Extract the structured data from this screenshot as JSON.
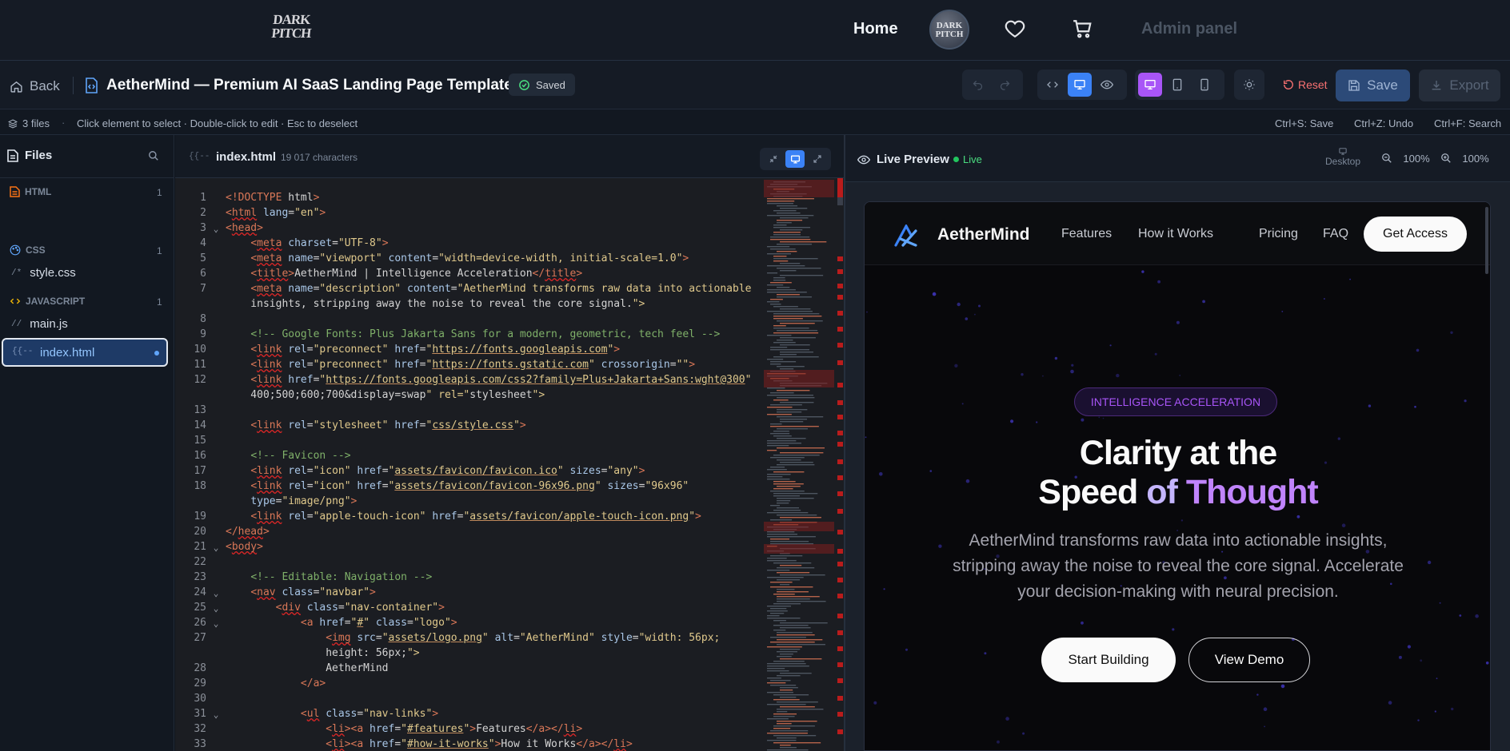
{
  "topnav": {
    "logo_line1": "DARK",
    "logo_line2": "PITCH",
    "home": "Home",
    "avatar_line1": "DARK",
    "avatar_line2": "PITCH",
    "admin": "Admin panel",
    "icons": [
      "heart-icon",
      "cart-icon"
    ]
  },
  "toolbar": {
    "back": "Back",
    "title": "AetherMind — Premium AI SaaS Landing Page Template",
    "saved": "Saved",
    "reset": "Reset",
    "save": "Save",
    "export": "Export"
  },
  "status": {
    "files": "3 files",
    "separator": "·",
    "hint": "Click element to select · Double-click to edit · Esc to deselect",
    "shortcuts": [
      "Ctrl+S: Save",
      "Ctrl+Z: Undo",
      "Ctrl+F: Search"
    ]
  },
  "sidebar": {
    "title": "Files",
    "categories": [
      {
        "label": "HTML",
        "count": "1",
        "files": [
          {
            "prefix": "{{--",
            "name": "index.html",
            "active": true
          }
        ]
      },
      {
        "label": "CSS",
        "count": "1",
        "files": [
          {
            "prefix": "/*",
            "name": "style.css"
          }
        ]
      },
      {
        "label": "JAVASCRIPT",
        "count": "1",
        "files": [
          {
            "prefix": "//",
            "name": "main.js"
          }
        ]
      }
    ]
  },
  "editor": {
    "tab_prefix": "{{--",
    "tab_name": "index.html",
    "char_count": "19 017 characters",
    "lines": [
      {
        "n": "1",
        "fold": "",
        "code": "<!DOCTYPE html>"
      },
      {
        "n": "2",
        "fold": "",
        "code": "<html lang=\"en\">"
      },
      {
        "n": "3",
        "fold": "v",
        "code": "<head>"
      },
      {
        "n": "4",
        "fold": "",
        "code": "    <meta charset=\"UTF-8\">"
      },
      {
        "n": "5",
        "fold": "",
        "code": "    <meta name=\"viewport\" content=\"width=device-width, initial-scale=1.0\">"
      },
      {
        "n": "6",
        "fold": "",
        "code": "    <title>AetherMind | Intelligence Acceleration</title>"
      },
      {
        "n": "7",
        "fold": "",
        "code": "    <meta name=\"description\" content=\"AetherMind transforms raw data into actionable"
      },
      {
        "n": "",
        "fold": "",
        "code": "    insights, stripping away the noise to reveal the core signal.\">"
      },
      {
        "n": "8",
        "fold": "",
        "code": ""
      },
      {
        "n": "9",
        "fold": "",
        "code": "    <!-- Google Fonts: Plus Jakarta Sans for a modern, geometric, tech feel -->"
      },
      {
        "n": "10",
        "fold": "",
        "code": "    <link rel=\"preconnect\" href=\"https://fonts.googleapis.com\">"
      },
      {
        "n": "11",
        "fold": "",
        "code": "    <link rel=\"preconnect\" href=\"https://fonts.gstatic.com\" crossorigin=\"\">"
      },
      {
        "n": "12",
        "fold": "",
        "code": "    <link href=\"https://fonts.googleapis.com/css2?family=Plus+Jakarta+Sans:wght@300;"
      },
      {
        "n": "",
        "fold": "",
        "code": "    400;500;600;700&display=swap\" rel=\"stylesheet\">"
      },
      {
        "n": "13",
        "fold": "",
        "code": ""
      },
      {
        "n": "14",
        "fold": "",
        "code": "    <link rel=\"stylesheet\" href=\"css/style.css\">"
      },
      {
        "n": "15",
        "fold": "",
        "code": ""
      },
      {
        "n": "16",
        "fold": "",
        "code": "    <!-- Favicon -->"
      },
      {
        "n": "17",
        "fold": "",
        "code": "    <link rel=\"icon\" href=\"assets/favicon/favicon.ico\" sizes=\"any\">"
      },
      {
        "n": "18",
        "fold": "",
        "code": "    <link rel=\"icon\" href=\"assets/favicon/favicon-96x96.png\" sizes=\"96x96\""
      },
      {
        "n": "",
        "fold": "",
        "code": "    type=\"image/png\">"
      },
      {
        "n": "19",
        "fold": "",
        "code": "    <link rel=\"apple-touch-icon\" href=\"assets/favicon/apple-touch-icon.png\">"
      },
      {
        "n": "20",
        "fold": "",
        "code": "</head>"
      },
      {
        "n": "21",
        "fold": "v",
        "code": "<body>"
      },
      {
        "n": "22",
        "fold": "",
        "code": ""
      },
      {
        "n": "23",
        "fold": "",
        "code": "    <!-- Editable: Navigation -->"
      },
      {
        "n": "24",
        "fold": "v",
        "code": "    <nav class=\"navbar\">"
      },
      {
        "n": "25",
        "fold": "v",
        "code": "        <div class=\"nav-container\">"
      },
      {
        "n": "26",
        "fold": "v",
        "code": "            <a href=\"#\" class=\"logo\">"
      },
      {
        "n": "27",
        "fold": "",
        "code": "                <img src=\"assets/logo.png\" alt=\"AetherMind\" style=\"width: 56px;"
      },
      {
        "n": "",
        "fold": "",
        "code": "                height: 56px;\">"
      },
      {
        "n": "28",
        "fold": "",
        "code": "                AetherMind"
      },
      {
        "n": "29",
        "fold": "",
        "code": "            </a>"
      },
      {
        "n": "30",
        "fold": "",
        "code": ""
      },
      {
        "n": "31",
        "fold": "v",
        "code": "            <ul class=\"nav-links\">"
      },
      {
        "n": "32",
        "fold": "",
        "code": "                <li><a href=\"#features\">Features</a></li>"
      },
      {
        "n": "33",
        "fold": "",
        "code": "                <li><a href=\"#how-it-works\">How it Works</a></li>"
      }
    ]
  },
  "preview": {
    "title": "Live Preview",
    "live": "Live",
    "device": "Desktop",
    "zoom1": "100%",
    "zoom2": "100%",
    "site": {
      "brand": "AetherMind",
      "links": [
        "Features",
        "How it Works",
        "Pricing",
        "FAQ"
      ],
      "cta": "Get Access",
      "badge": "INTELLIGENCE ACCELERATION",
      "headline_line1": "Clarity at the",
      "headline_line2_a": "Speed ",
      "headline_line2_b": "of ",
      "headline_line2_c": "Thought",
      "paragraph": "AetherMind transforms raw data into actionable insights, stripping away the noise to reveal the core signal. Accelerate your decision-making with neural precision.",
      "primary_button": "Start Building",
      "secondary_button": "View Demo"
    }
  },
  "colors": {
    "accent_blue": "#3b82f6",
    "accent_purple": "#a855f7",
    "danger": "#f87171",
    "live_green": "#22c55e"
  }
}
